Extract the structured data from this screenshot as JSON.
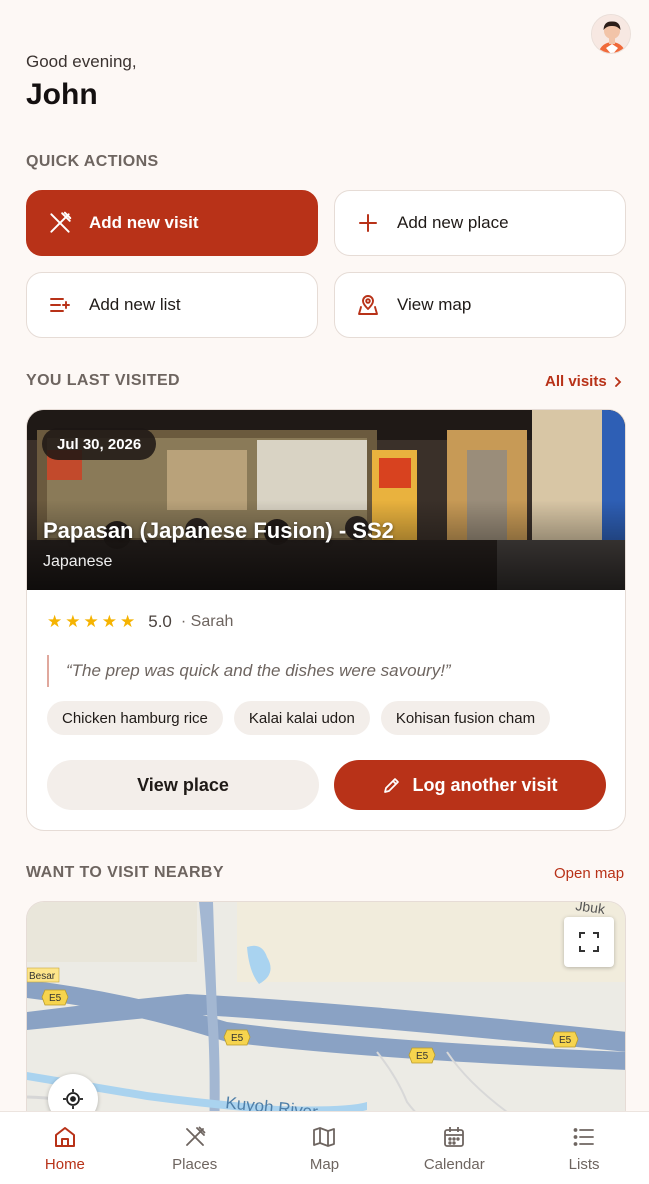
{
  "header": {
    "greeting": "Good evening,",
    "user_name": "John"
  },
  "quick_actions": {
    "heading": "QUICK ACTIONS",
    "items": [
      {
        "label": "Add new visit",
        "icon": "utensils-icon"
      },
      {
        "label": "Add new place",
        "icon": "plus-icon"
      },
      {
        "label": "Add new list",
        "icon": "list-add-icon"
      },
      {
        "label": "View map",
        "icon": "map-pin-icon"
      }
    ]
  },
  "last_visited": {
    "heading": "YOU LAST VISITED",
    "link": "All visits",
    "date": "Jul 30, 2026",
    "place_name": "Papasan (Japanese Fusion) - SS2",
    "cuisine": "Japanese",
    "stars": 5,
    "rating": "5.0",
    "author": "· Sarah",
    "quote": "“The prep was quick and the dishes were savoury!”",
    "dishes": [
      "Chicken hamburg rice",
      "Kalai kalai udon",
      "Kohisan fusion cham"
    ],
    "view_button": "View place",
    "log_button": "Log another visit"
  },
  "nearby": {
    "heading": "WANT TO VISIT NEARBY",
    "link": "Open map",
    "map_labels": {
      "river": "Kuyoh River",
      "road_tag": "Besar",
      "highway": "E5",
      "corner": "Jbuk"
    }
  },
  "tabs": [
    {
      "label": "Home",
      "icon": "home-icon",
      "active": true
    },
    {
      "label": "Places",
      "icon": "utensils-icon",
      "active": false
    },
    {
      "label": "Map",
      "icon": "map-icon",
      "active": false
    },
    {
      "label": "Calendar",
      "icon": "calendar-icon",
      "active": false
    },
    {
      "label": "Lists",
      "icon": "list-icon",
      "active": false
    }
  ],
  "colors": {
    "accent": "#b83218",
    "background": "#fdf8f5",
    "star": "#f5b301"
  }
}
